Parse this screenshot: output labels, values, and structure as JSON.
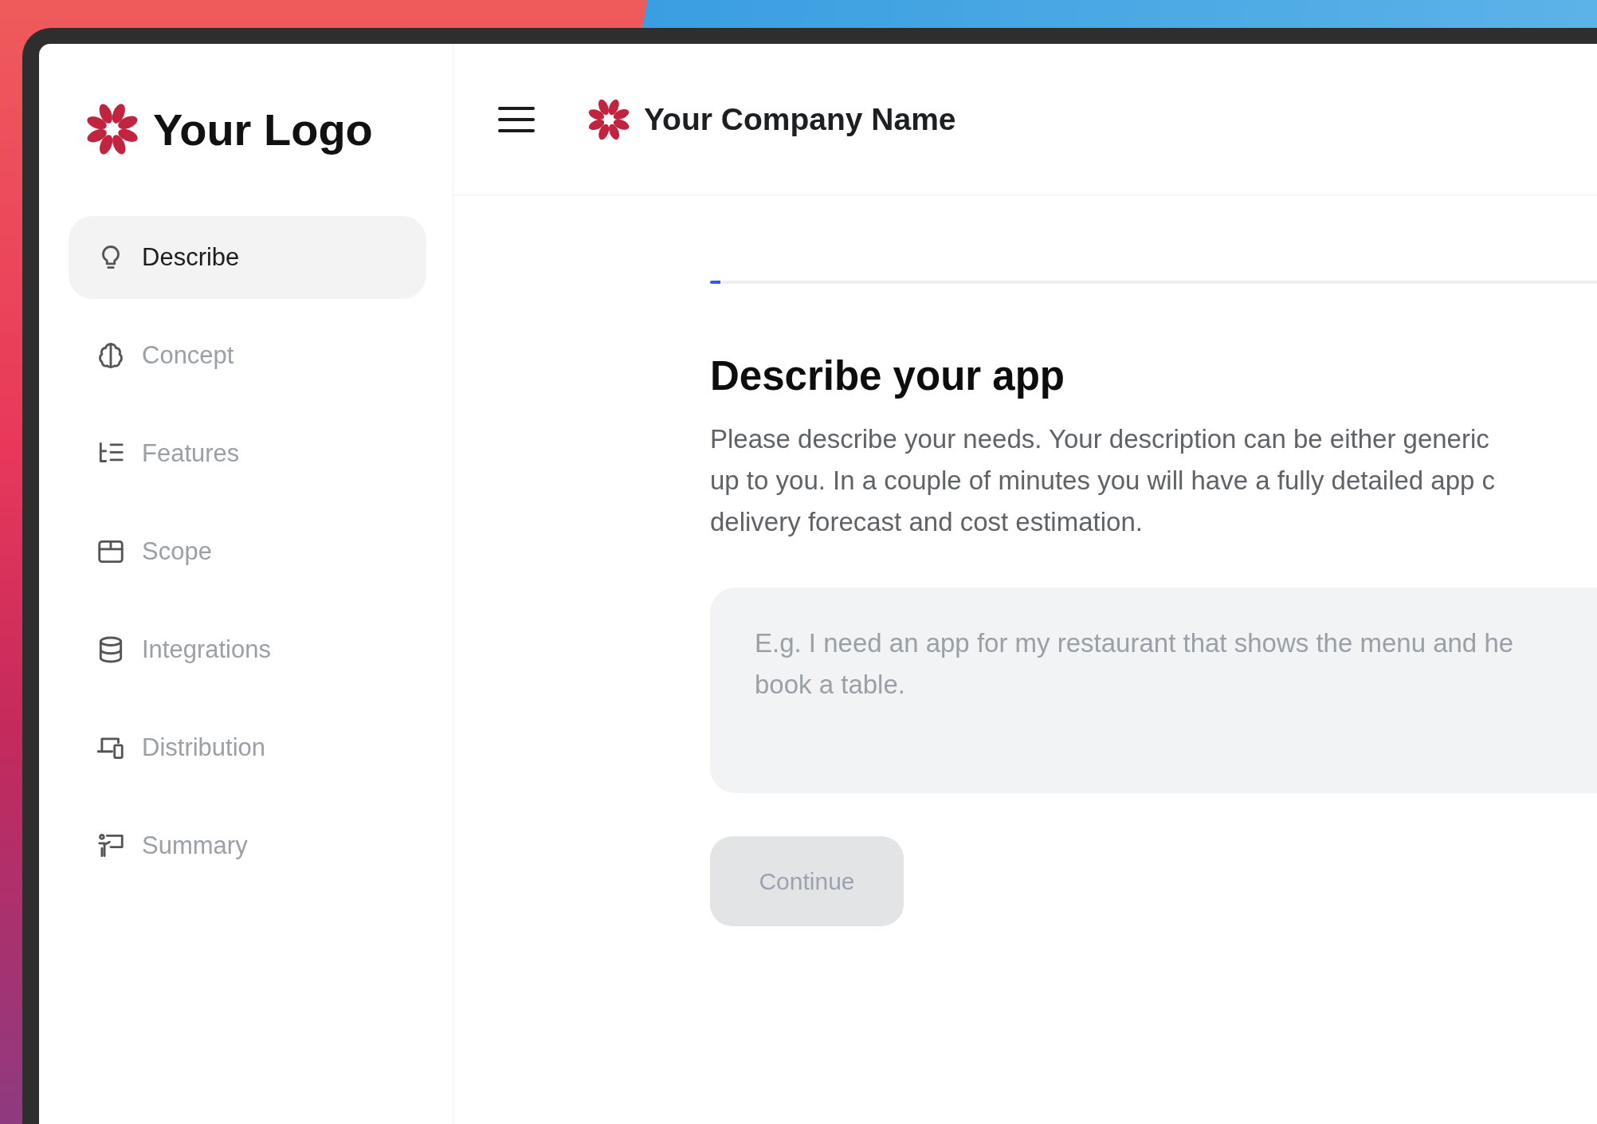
{
  "sidebar": {
    "logo_text": "Your Logo",
    "items": [
      {
        "label": "Describe",
        "selected": true
      },
      {
        "label": "Concept",
        "selected": false
      },
      {
        "label": "Features",
        "selected": false
      },
      {
        "label": "Scope",
        "selected": false
      },
      {
        "label": "Integrations",
        "selected": false
      },
      {
        "label": "Distribution",
        "selected": false
      },
      {
        "label": "Summary",
        "selected": false
      }
    ]
  },
  "header": {
    "company_name": "Your Company Name"
  },
  "progress": {
    "level": 0.01
  },
  "main": {
    "title": "Describe your app",
    "description_lines": [
      "Please describe your needs. Your description can be either generic",
      "up to you. In a couple of minutes you will have a fully detailed app c",
      "delivery forecast and cost estimation."
    ],
    "input": {
      "placeholder": "E.g. I need an app for my restaurant that shows the menu and he\nbook a table."
    },
    "continue_button": {
      "label": "Continue",
      "disabled": true
    }
  }
}
